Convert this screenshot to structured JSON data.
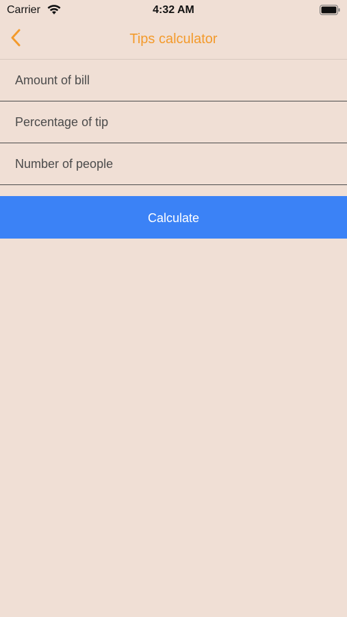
{
  "status_bar": {
    "carrier": "Carrier",
    "time": "4:32 AM",
    "wifi_icon": "wifi-icon",
    "battery_icon": "battery-icon"
  },
  "nav": {
    "title": "Tips calculator",
    "back_icon": "chevron-left-icon",
    "accent_color": "#f39a2b"
  },
  "form": {
    "fields": [
      {
        "placeholder": "Amount of bill",
        "value": ""
      },
      {
        "placeholder": "Percentage of tip",
        "value": ""
      },
      {
        "placeholder": "Number of people",
        "value": ""
      }
    ],
    "calculate_label": "Calculate",
    "button_color": "#3b82f6"
  },
  "theme": {
    "background": "#f0dfd5"
  }
}
